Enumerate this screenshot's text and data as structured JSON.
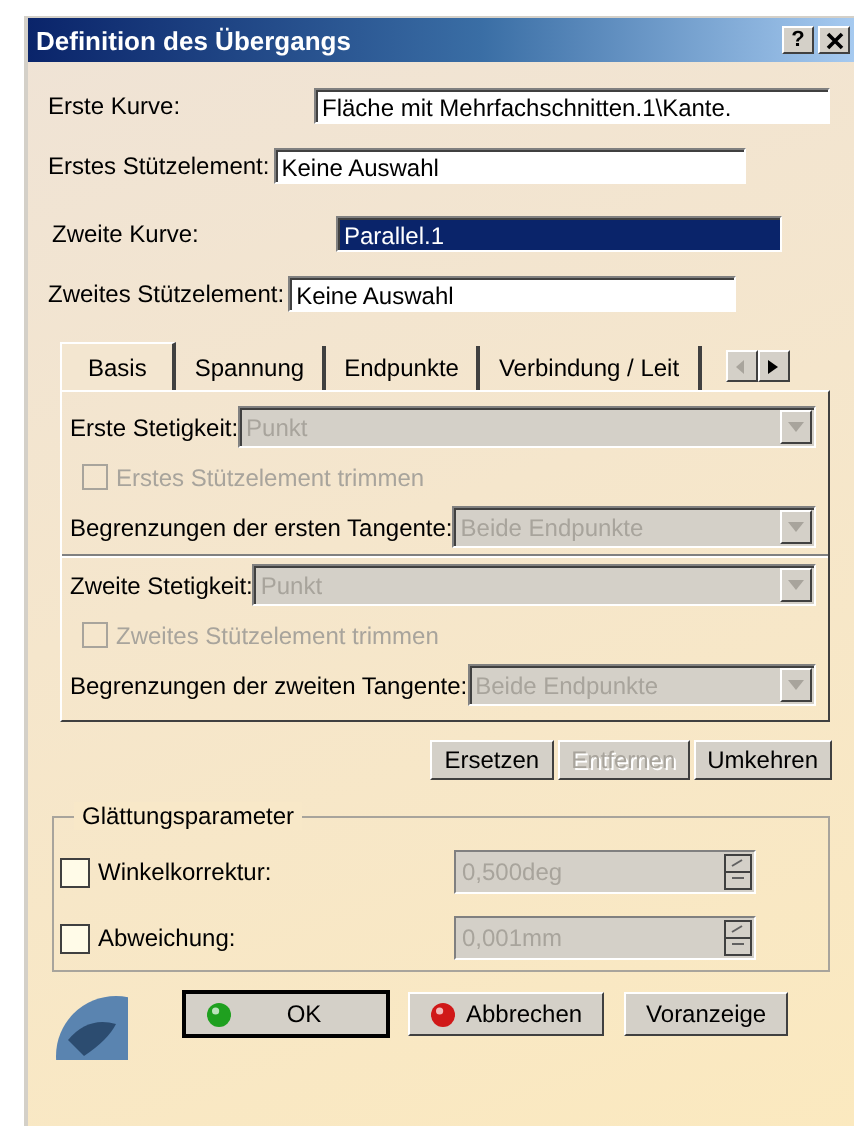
{
  "window": {
    "title": "Definition des Übergangs",
    "help_button": "?"
  },
  "fields": [
    {
      "label": "Erste Kurve:",
      "value": "Fläche mit Mehrfachschnitten.1\\Kante.",
      "selected": false
    },
    {
      "label": "Erstes Stützelement:",
      "value": "Keine Auswahl",
      "selected": false
    },
    {
      "label": "Zweite Kurve:",
      "value": "Parallel.1",
      "selected": true
    },
    {
      "label": "Zweites Stützelement:",
      "value": "Keine Auswahl",
      "selected": false
    }
  ],
  "tabs": [
    {
      "label": "Basis",
      "selected": true
    },
    {
      "label": "Spannung",
      "selected": false
    },
    {
      "label": "Endpunkte",
      "selected": false
    },
    {
      "label": "Verbindung / Leit",
      "selected": false
    }
  ],
  "tab_panel": [
    {
      "continuity": {
        "label": "Erste Stetigkeit:",
        "value": "Punkt",
        "disabled": true
      },
      "trim": {
        "label": "Erstes Stützelement trimmen",
        "checked": false,
        "disabled": true
      },
      "tangent": {
        "label": "Begrenzungen der ersten Tangente:",
        "value": "Beide Endpunkte",
        "disabled": true
      }
    },
    {
      "continuity": {
        "label": "Zweite Stetigkeit:",
        "value": "Punkt",
        "disabled": true
      },
      "trim": {
        "label": "Zweites Stützelement trimmen",
        "checked": false,
        "disabled": true
      },
      "tangent": {
        "label": "Begrenzungen der zweiten Tangente:",
        "value": "Beide Endpunkte",
        "disabled": true
      }
    }
  ],
  "actions": [
    {
      "label": "Ersetzen",
      "disabled": false
    },
    {
      "label": "Entfernen",
      "disabled": true
    },
    {
      "label": "Umkehren",
      "disabled": false
    }
  ],
  "smoothing": {
    "title": "Glättungsparameter",
    "rows": [
      {
        "label": "Winkelkorrektur:",
        "checked": false,
        "value": "0,500deg",
        "disabled": true
      },
      {
        "label": "Abweichung:",
        "checked": false,
        "value": "0,001mm",
        "disabled": true
      }
    ]
  },
  "footer_buttons": [
    {
      "label": "OK",
      "kind": "ok",
      "focused": true
    },
    {
      "label": "Abbrechen",
      "kind": "cancel",
      "focused": false
    },
    {
      "label": "Voranzeige",
      "kind": "plain",
      "focused": false
    }
  ]
}
